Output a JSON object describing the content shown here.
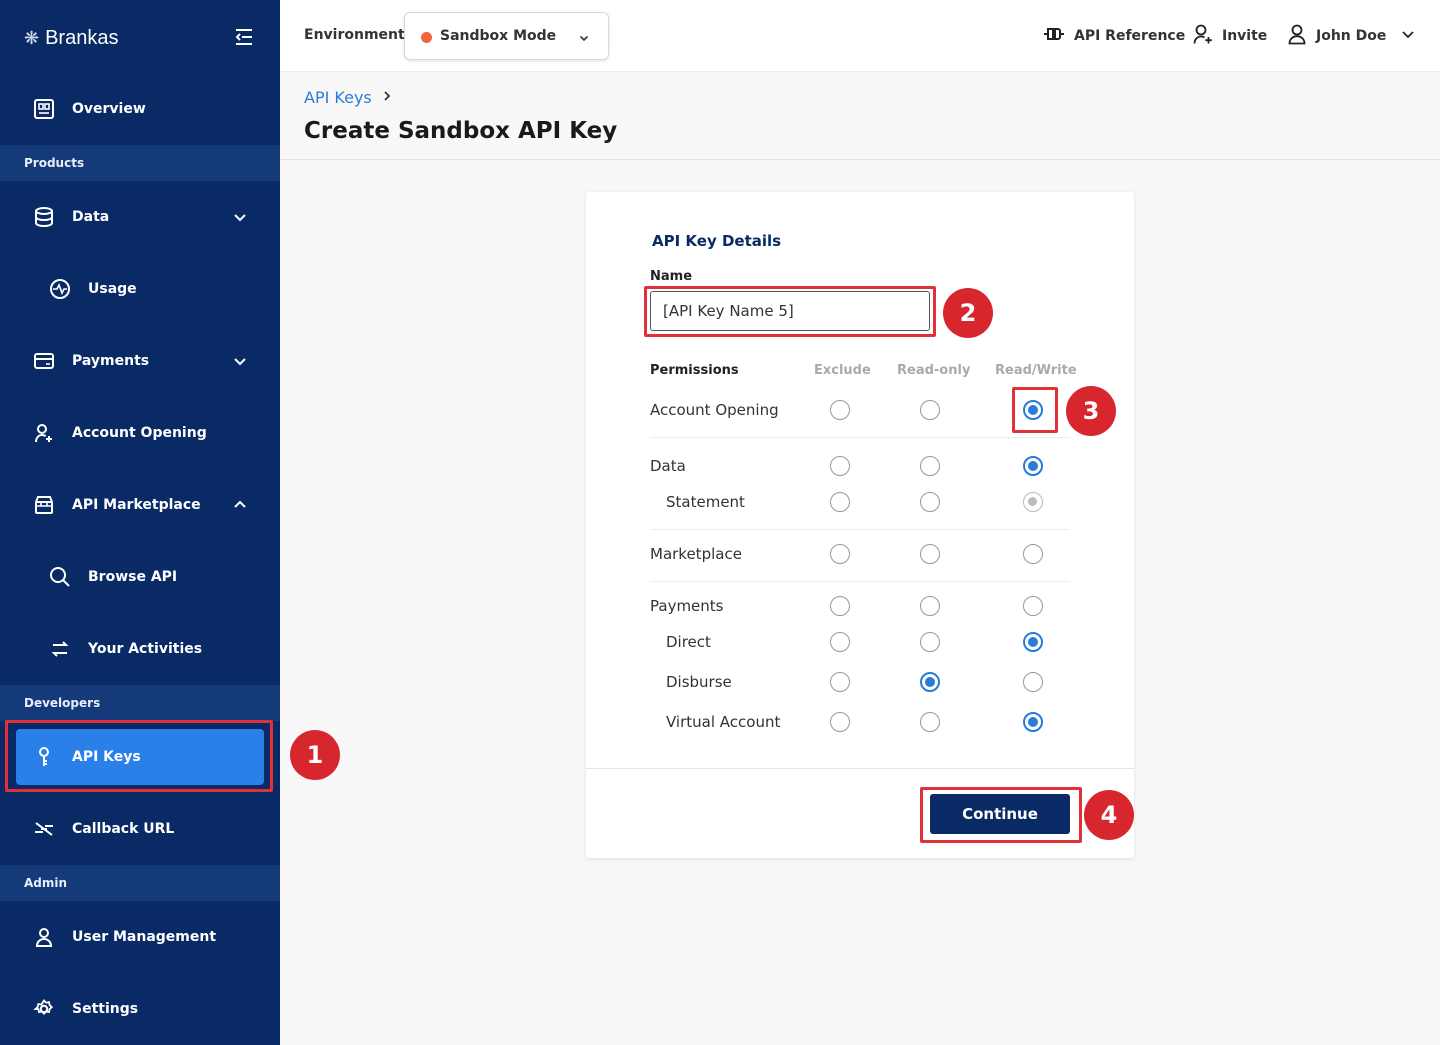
{
  "brand": {
    "name": "Brankas",
    "mark": "❋"
  },
  "sidebar": {
    "overview": "Overview",
    "sections": {
      "products": "Products",
      "developers": "Developers",
      "admin": "Admin"
    },
    "items": {
      "data": "Data",
      "usage": "Usage",
      "payments": "Payments",
      "account_opening": "Account Opening",
      "api_marketplace": "API Marketplace",
      "browse_api": "Browse API",
      "your_activities": "Your Activities",
      "api_keys": "API Keys",
      "callback_url": "Callback URL",
      "user_management": "User Management",
      "settings": "Settings"
    }
  },
  "topbar": {
    "environment_label": "Environment:",
    "environment_value": "Sandbox Mode",
    "api_reference": "API Reference",
    "invite": "Invite",
    "user": "John Doe"
  },
  "page": {
    "breadcrumb": "API Keys",
    "title": "Create Sandbox API Key"
  },
  "form": {
    "section_title": "API Key Details",
    "name_label": "Name",
    "name_value": "[API Key Name 5]",
    "permissions": {
      "header": "Permissions",
      "columns": [
        "Exclude",
        "Read-only",
        "Read/Write"
      ],
      "rows": [
        {
          "label": "Account Opening",
          "selected": "Read/Write"
        },
        {
          "label": "Data",
          "selected": "Read/Write"
        },
        {
          "label": "Statement",
          "selected": "Read/Write",
          "disabled": true
        },
        {
          "label": "Marketplace",
          "selected": ""
        },
        {
          "label": "Payments",
          "selected": ""
        },
        {
          "label": "Direct",
          "selected": "Read/Write"
        },
        {
          "label": "Disburse",
          "selected": "Read-only"
        },
        {
          "label": "Virtual Account",
          "selected": "Read/Write"
        }
      ]
    },
    "continue_label": "Continue"
  },
  "annotations": [
    "1",
    "2",
    "3",
    "4"
  ],
  "colors": {
    "sidebar_bg": "#0a2a66",
    "active_item": "#2a80e8",
    "accent": "#2a7ad8",
    "highlight": "#e0313a",
    "sandbox_dot": "#f2643a"
  }
}
